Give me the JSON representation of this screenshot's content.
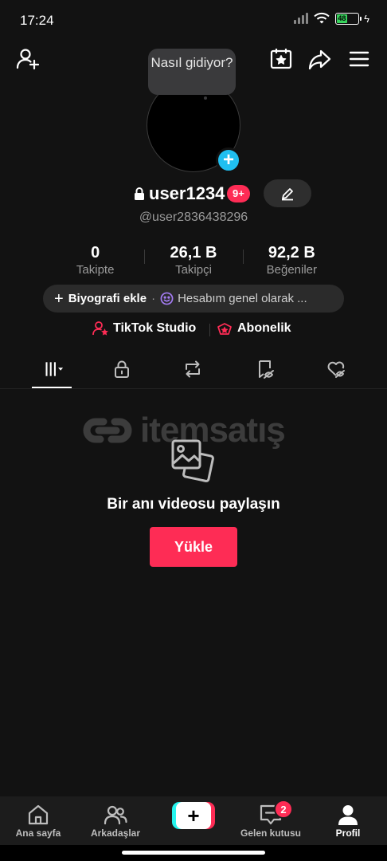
{
  "status": {
    "time": "17:24",
    "battery": "48",
    "battery_color": "#37d35c"
  },
  "header": {
    "icons": [
      "add-friend-icon",
      "calendar-star-icon",
      "share-icon",
      "menu-icon"
    ]
  },
  "profile": {
    "bubble_text": "Nasıl gidiyor?",
    "username": "user1234",
    "notification_badge": "9+",
    "handle": "@user2836438296",
    "stats": [
      {
        "value": "0",
        "label": "Takipte"
      },
      {
        "value": "26,1 B",
        "label": "Takipçi"
      },
      {
        "value": "92,2 B",
        "label": "Beğeniler"
      }
    ],
    "bio_add_label": "Biyografi ekle",
    "bio_separator": "·",
    "bio_status": "Hesabım genel olarak ...",
    "links": {
      "studio": "TikTok Studio",
      "subscription": "Abonelik"
    }
  },
  "tabs": {
    "items": [
      "videos-grid",
      "private-lock",
      "reposts",
      "favorites",
      "liked"
    ],
    "active": "videos-grid"
  },
  "watermark": {
    "text": "itemsatış"
  },
  "empty_state": {
    "title": "Bir anı videosu paylaşın",
    "button": "Yükle"
  },
  "bottom_nav": {
    "home": "Ana sayfa",
    "friends": "Arkadaşlar",
    "create_symbol": "+",
    "inbox": "Gelen kutusu",
    "inbox_badge": "2",
    "profile": "Profil"
  },
  "colors": {
    "accent": "#fe2c55",
    "cyan": "#25f4ee",
    "avatar_add": "#20bff0",
    "background": "#121212"
  }
}
